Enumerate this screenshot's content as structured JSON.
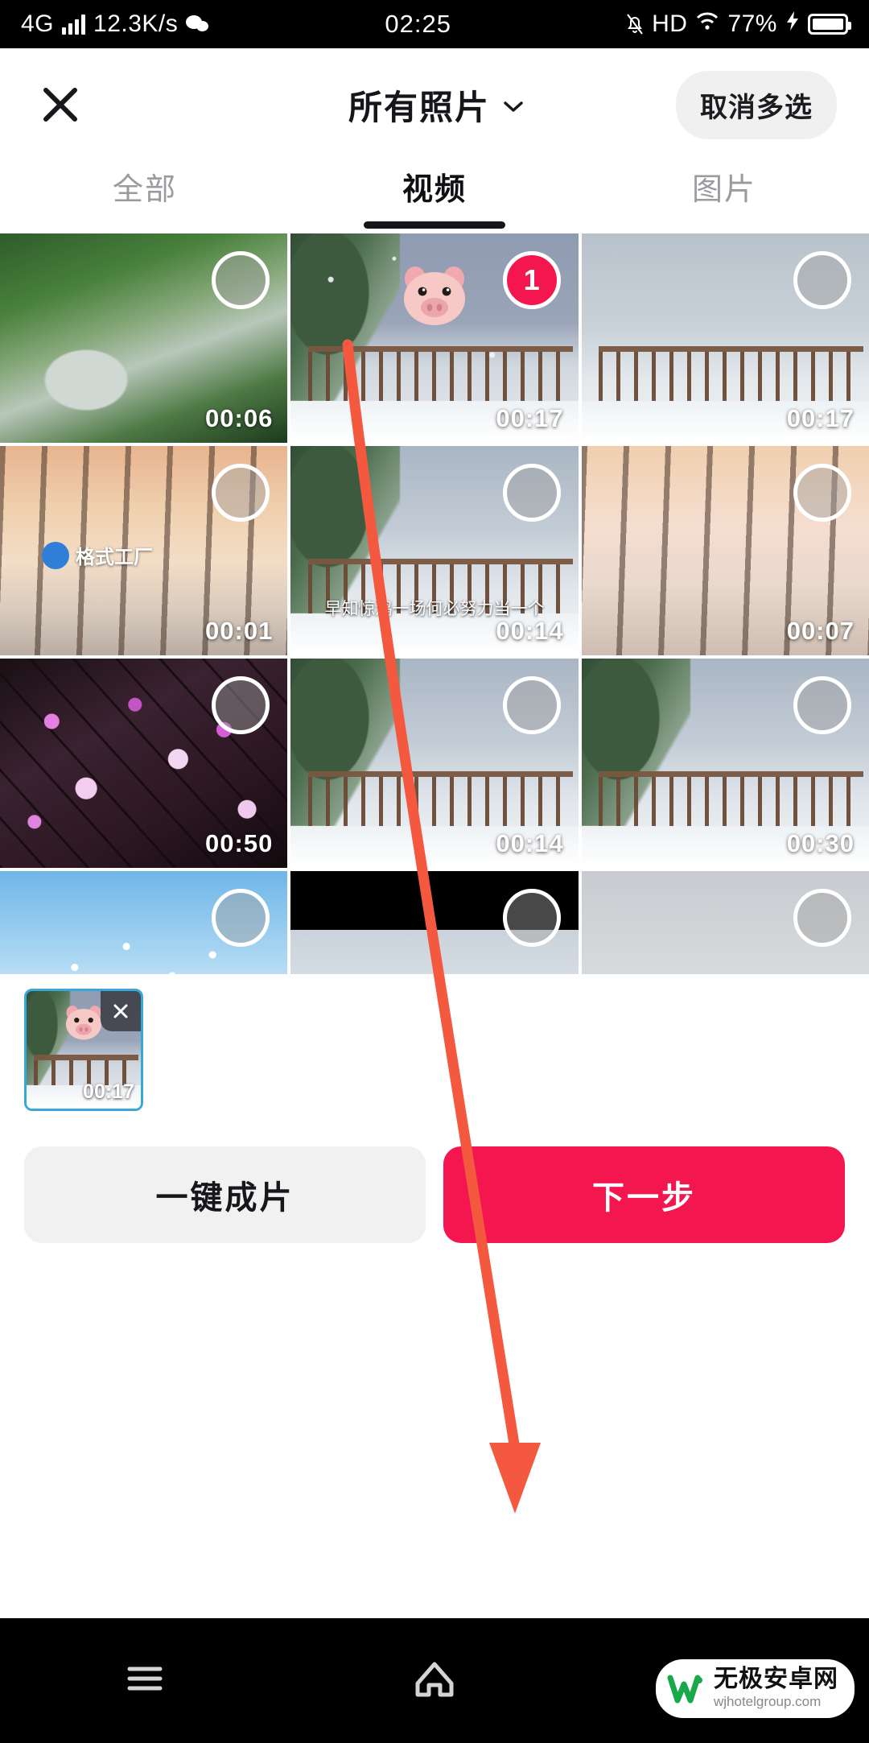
{
  "statusbar": {
    "network": "4G",
    "speed": "12.3K/s",
    "app_icon": "wechat-icon",
    "time": "02:25",
    "mute_icon": "bell-off-icon",
    "hd": "HD",
    "wifi_icon": "wifi-icon",
    "battery_percent": "77%",
    "charging_icon": "bolt-icon"
  },
  "header": {
    "close_icon": "close-icon",
    "title": "所有照片",
    "chevron_icon": "chevron-down-icon",
    "multi_select_button": "取消多选"
  },
  "tabs": [
    {
      "label": "全部",
      "active": false
    },
    {
      "label": "视频",
      "active": true
    },
    {
      "label": "图片",
      "active": false
    }
  ],
  "grid": {
    "items": [
      {
        "duration": "00:06",
        "selected": false,
        "badge": "",
        "scene": "waterfall"
      },
      {
        "duration": "00:17",
        "selected": true,
        "badge": "1",
        "scene": "snow-deck",
        "sticker": "pig-face-sticker"
      },
      {
        "duration": "00:17",
        "selected": false,
        "badge": "",
        "scene": "snow-deck2"
      },
      {
        "duration": "00:01",
        "selected": false,
        "badge": "",
        "scene": "sunset-trees",
        "watermark": "格式工厂"
      },
      {
        "duration": "00:14",
        "selected": false,
        "badge": "",
        "scene": "tree-snow",
        "caption": "早知惊鸿一场何必努力当一个"
      },
      {
        "duration": "00:07",
        "selected": false,
        "badge": "",
        "scene": "sunset-trees2"
      },
      {
        "duration": "00:50",
        "selected": false,
        "badge": "",
        "scene": "night-blossom"
      },
      {
        "duration": "00:14",
        "selected": false,
        "badge": "",
        "scene": "tree-snow"
      },
      {
        "duration": "00:30",
        "selected": false,
        "badge": "",
        "scene": "tree-snow"
      },
      {
        "duration": "",
        "selected": false,
        "badge": "",
        "scene": "blue-sky-birds"
      },
      {
        "duration": "",
        "selected": false,
        "badge": "",
        "scene": "letterbox-snow"
      },
      {
        "duration": "",
        "selected": false,
        "badge": "",
        "scene": "grey-sky"
      }
    ]
  },
  "selected_strip": {
    "items": [
      {
        "duration": "00:17",
        "remove_icon": "close-icon",
        "sticker": "pig-face-sticker"
      }
    ]
  },
  "actions": {
    "secondary_label": "一键成片",
    "primary_label": "下一步"
  },
  "navbar": {
    "recents_icon": "menu-icon",
    "home_icon": "home-icon",
    "back_icon": "back-icon"
  },
  "annotation": {
    "arrow_color": "#f4593f"
  },
  "watermark": {
    "name": "无极安卓网",
    "url": "wjhotelgroup.com"
  },
  "colors": {
    "accent_red": "#f4174f",
    "tab_active": "#16161a",
    "tab_inactive": "#9a9a9f",
    "chip_bg": "#f0f0f0"
  }
}
